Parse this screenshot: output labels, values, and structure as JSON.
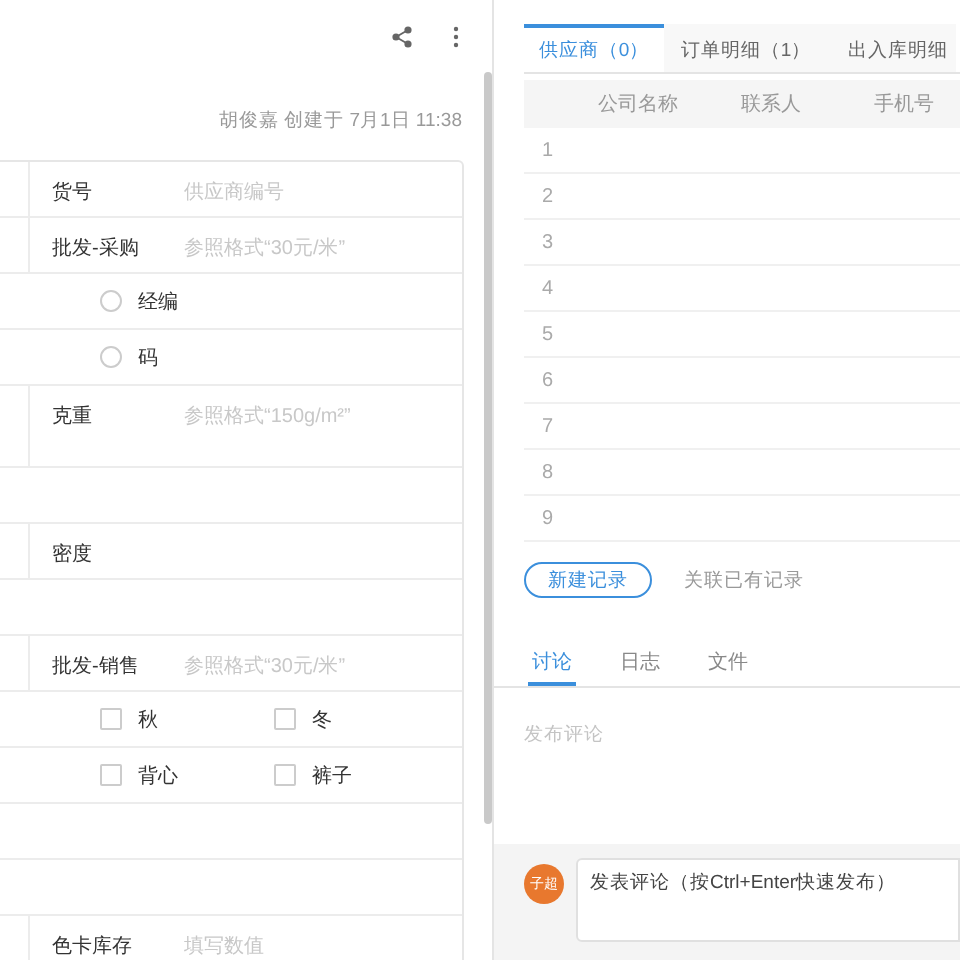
{
  "header": {
    "created": "胡俊嘉 创建于 7月1日 11:38"
  },
  "form": {
    "rows": [
      {
        "kind": "field",
        "label": "货号",
        "placeholder": "供应商编号"
      },
      {
        "kind": "field",
        "label": "批发-采购",
        "placeholder": "参照格式“30元/米”"
      },
      {
        "kind": "radio",
        "options": [
          {
            "label": "经编",
            "selected": false
          }
        ]
      },
      {
        "kind": "radio",
        "options": [
          {
            "label": "码",
            "selected": false
          }
        ]
      },
      {
        "kind": "textarea",
        "label": "克重",
        "placeholder": "参照格式“150g/m²”"
      },
      {
        "kind": "empty"
      },
      {
        "kind": "field",
        "label": "密度"
      },
      {
        "kind": "empty"
      },
      {
        "kind": "field",
        "label": "批发-销售",
        "placeholder": "参照格式“30元/米”"
      },
      {
        "kind": "checkbox",
        "options": [
          {
            "label": "秋",
            "checked": false
          },
          {
            "label": "冬",
            "checked": false
          }
        ]
      },
      {
        "kind": "checkbox",
        "options": [
          {
            "label": "背心",
            "checked": false
          },
          {
            "label": "裤子",
            "checked": false
          }
        ]
      },
      {
        "kind": "empty"
      },
      {
        "kind": "empty"
      },
      {
        "kind": "field",
        "label": "色卡库存",
        "placeholder": "填写数值"
      }
    ]
  },
  "tabs": [
    {
      "label": "供应商（0）",
      "selected": true
    },
    {
      "label": "订单明细（1）",
      "selected": false
    },
    {
      "label": "出入库明细",
      "selected": false
    }
  ],
  "table": {
    "columns": [
      "公司名称",
      "联系人",
      "手机号"
    ],
    "rows": [
      "1",
      "2",
      "3",
      "4",
      "5",
      "6",
      "7",
      "8",
      "9"
    ]
  },
  "actions": {
    "new_record": "新建记录",
    "link_record": "关联已有记录"
  },
  "activity_tabs": [
    {
      "label": "讨论",
      "selected": true
    },
    {
      "label": "日志",
      "selected": false
    },
    {
      "label": "文件",
      "selected": false
    }
  ],
  "comments": {
    "placeholder": "发布评论"
  },
  "composer": {
    "avatar": "子超",
    "placeholder": "发表评论（按Ctrl+Enter快速发布）"
  }
}
